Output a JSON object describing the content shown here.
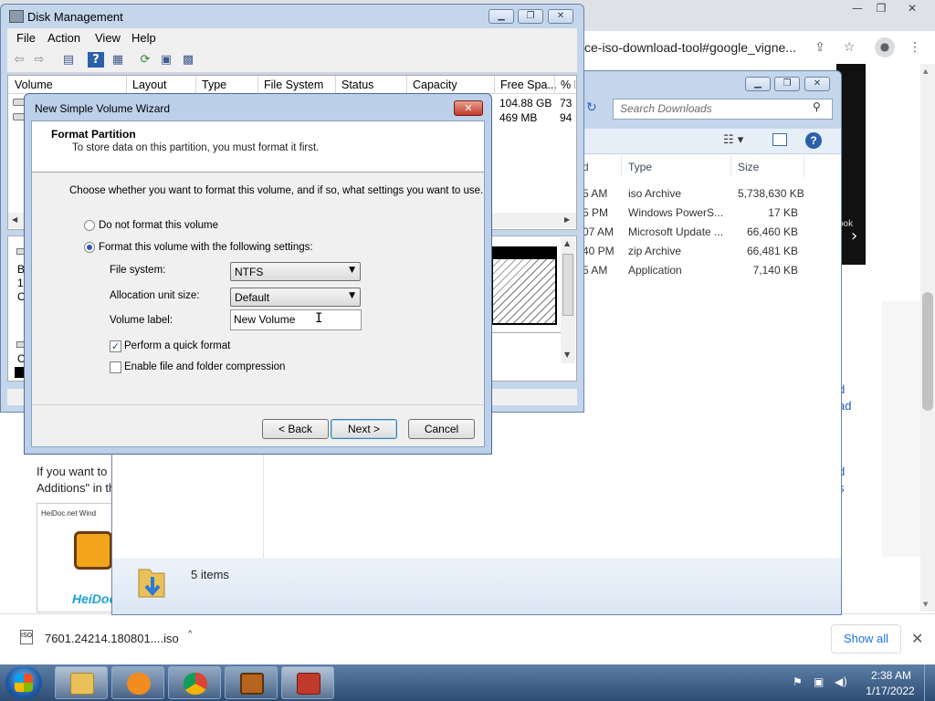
{
  "chrome": {
    "url_fragment": "ce-iso-download-tool#google_vigne...",
    "window_buttons": {
      "minimize": "—",
      "restore": "❐",
      "close": "✕"
    },
    "page_text_lines": [
      "If you want to",
      "Additions\" in th"
    ],
    "page_links": [
      "d",
      "ad",
      "",
      "",
      "d",
      "s"
    ],
    "thumb_caption": "HeiDoc.net Wind",
    "logo_text": "HeiDoc",
    "download_bar": {
      "file_icon": "ISO",
      "file_name": "7601.24214.180801....iso",
      "show_all": "Show all"
    }
  },
  "explorer": {
    "search_placeholder": "Search Downloads",
    "headers": {
      "type": "Type",
      "size": "Size"
    },
    "rows": [
      {
        "time": "5 AM",
        "type": "iso Archive",
        "size": "5,738,630 KB"
      },
      {
        "time": "5 PM",
        "type": "Windows PowerS...",
        "size": "17 KB"
      },
      {
        "time": "07 AM",
        "type": "Microsoft Update ...",
        "size": "66,460 KB"
      },
      {
        "time": "40 PM",
        "type": "zip Archive",
        "size": "66,481 KB"
      },
      {
        "time": "5 AM",
        "type": "Application",
        "size": "7,140 KB"
      }
    ],
    "header_partial": "d",
    "status": "5 items",
    "side_label": "ook"
  },
  "disk_management": {
    "title": "Disk Management",
    "menu": [
      "File",
      "Action",
      "View",
      "Help"
    ],
    "columns": [
      "Volume",
      "Layout",
      "Type",
      "File System",
      "Status",
      "Capacity",
      "Free Spa...",
      "% F"
    ],
    "rows": [
      {
        "free": "104.88 GB",
        "pct": "73"
      },
      {
        "free": "469 MB",
        "pct": "94"
      }
    ],
    "left_chars": [
      "B",
      "1",
      "O",
      "C"
    ]
  },
  "wizard": {
    "title": "New Simple Volume Wizard",
    "close": "✕",
    "header_title": "Format Partition",
    "header_subtitle": "To store data on this partition, you must format it first.",
    "intro": "Choose whether you want to format this volume, and if so, what settings you want to use.",
    "radio_no_format": "Do not format this volume",
    "radio_format": "Format this volume with the following settings:",
    "file_system_label": "File system:",
    "file_system_value": "NTFS",
    "alloc_label": "Allocation unit size:",
    "alloc_value": "Default",
    "volume_label_label": "Volume label:",
    "volume_label_value": "New Volume",
    "quick_format": "Perform a quick format",
    "quick_format_checked": true,
    "compression": "Enable file and folder compression",
    "compression_checked": false,
    "back": "< Back",
    "next": "Next >",
    "cancel": "Cancel"
  },
  "taskbar": {
    "time": "2:38 AM",
    "date": "1/17/2022",
    "apps": [
      "file-explorer",
      "media-player",
      "chrome",
      "toolbox",
      "disk-management"
    ]
  },
  "colors": {
    "aero_frame": "#c4d6ec",
    "wizard_frame": "#bcd0ea",
    "link_blue": "#1a57c7",
    "taskbar": "#2e4d74"
  }
}
